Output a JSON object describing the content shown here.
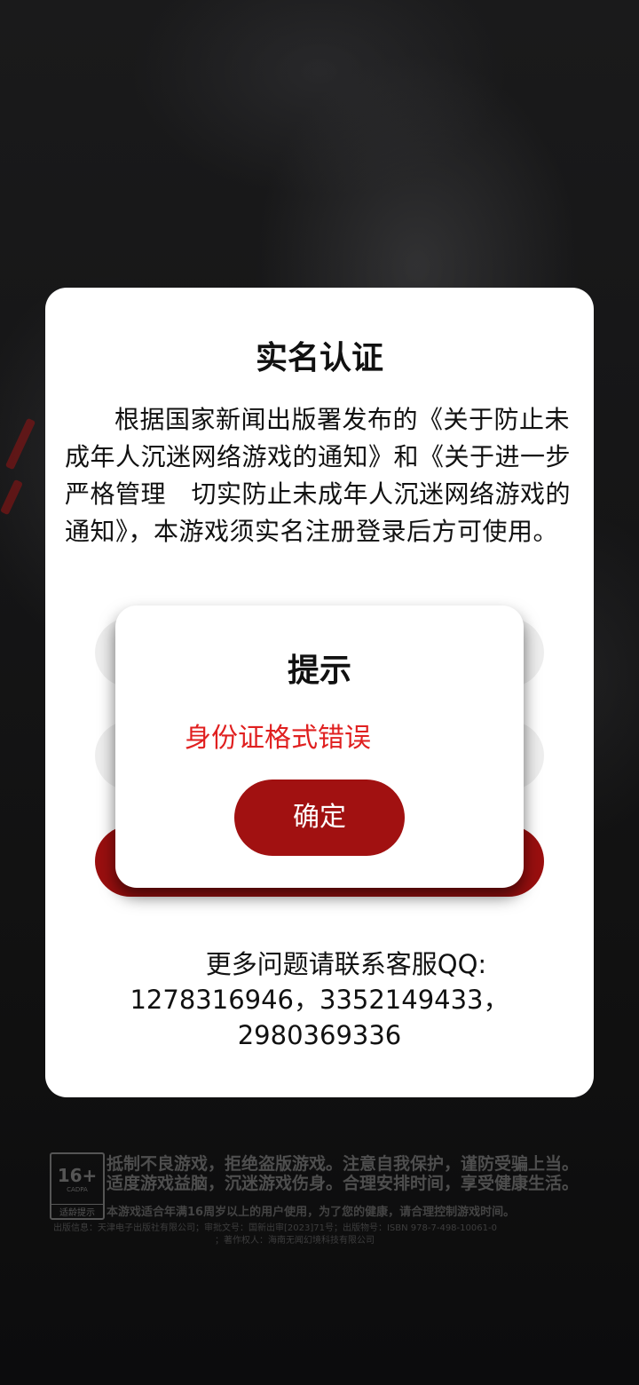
{
  "realname_card": {
    "title": "实名认证",
    "notice": "根据国家新闻出版署发布的《关于防止未成年人沉迷网络游戏的通知》和《关于进一步严格管理　切实防止未成年人沉迷网络游戏的通知》，本游戏须实名注册登录后方可使用。",
    "contact_line1": "更多问题请联系客服QQ:",
    "contact_line2": "1278316946，3352149433，",
    "contact_line3": "2980369336"
  },
  "dialog": {
    "title": "提示",
    "message": "身份证格式错误",
    "confirm_label": "确定"
  },
  "footer": {
    "age_rating": "16+",
    "age_rating_sub": "CADPA",
    "age_tip": "适龄提示",
    "slogan_line1": "抵制不良游戏，拒绝盗版游戏。注意自我保护，谨防受骗上当。",
    "slogan_line2": "适度游戏益脑，沉迷游戏伤身。合理安排时间，享受健康生活。",
    "age_note": "本游戏适合年满16周岁以上的用户使用，为了您的健康，请合理控制游戏时间。",
    "publish_info_line1": "出版信息：天津电子出版社有限公司；审批文号：国新出审[2023]71号；出版物号：ISBN 978-7-498-10061-0",
    "publish_info_line2": "；著作权人：海南无闻幻境科技有限公司"
  }
}
